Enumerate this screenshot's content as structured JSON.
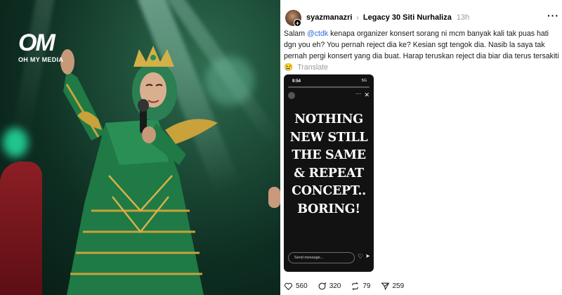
{
  "photo": {
    "logo_mark": "OM",
    "logo_text": "OH MY MEDIA"
  },
  "post": {
    "username": "syazmanazri",
    "topic": "Legacy 30 Siti Nurhaliza",
    "time": "13h",
    "caption_prefix": "Salam ",
    "caption_mention": "@ctdk",
    "caption_body": " kenapa organizer konsert sorang ni mcm banyak kali tak puas hati dgn you eh? You pernah reject dia ke? Kesian sgt tengok dia. Nasib la saya tak pernah pergi konsert yang dia buat. Harap teruskan reject dia biar dia terus tersakiti",
    "caption_emoji": "😢",
    "translate_label": "Translate",
    "story": {
      "time": "9:54",
      "signal": "5G",
      "text": "NOTHING NEW STILL THE SAME & REPEAT CONCEPT.. BORING!",
      "input_placeholder": "Send message..."
    },
    "counts": {
      "likes": "560",
      "comments": "320",
      "reposts": "79",
      "shares": "259"
    }
  }
}
